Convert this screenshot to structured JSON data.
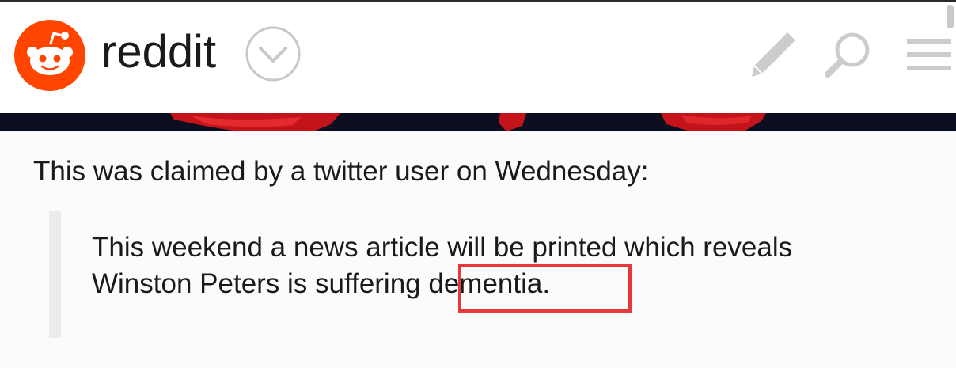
{
  "header": {
    "brand": "reddit",
    "logo_icon": "reddit-alien-icon",
    "dropdown_icon": "chevron-down-icon",
    "actions": [
      {
        "icon": "pencil-icon"
      },
      {
        "icon": "search-icon"
      },
      {
        "icon": "hamburger-menu-icon"
      }
    ],
    "brand_color": "#ff4500"
  },
  "post": {
    "intro_text": "This was claimed by a twitter user on Wednesday:",
    "quote_line1": "This weekend a news article will be printed which reveals",
    "quote_line2_prefix": "Winston Peters is suffering ",
    "quote_highlight": "dementia.",
    "highlight_color": "#e8373d"
  }
}
